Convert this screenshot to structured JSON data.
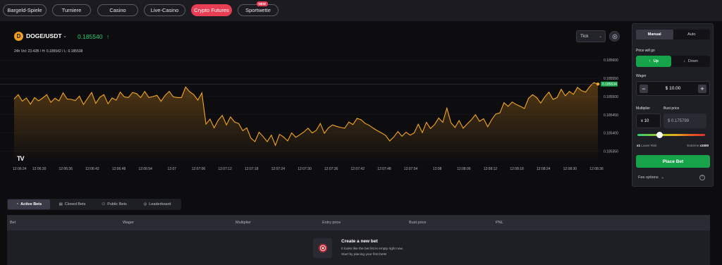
{
  "nav": {
    "items": [
      {
        "label": "Bargeld-Spiele"
      },
      {
        "label": "Turniere"
      },
      {
        "label": "Casino"
      },
      {
        "label": "Live-Casino"
      },
      {
        "label": "Crypto Futures"
      },
      {
        "label": "Sportwette"
      }
    ],
    "new_badge": "NEW"
  },
  "chart_header": {
    "coin_symbol": "D",
    "pair": "DOGE/USDT",
    "price": "0.185540",
    "price_arrow": "↑",
    "stats": "24h Vol: 23.42B / H: 0.185542 / L: 0.185538",
    "interval": "Tick"
  },
  "chart_data": {
    "type": "area",
    "series_color": "#f5a623",
    "current_price_label": "0.185534",
    "y_ticks": [
      "0.185600",
      "0.185550",
      "0.185500",
      "0.185450",
      "0.185400",
      "0.185350"
    ],
    "x_ticks": [
      "12:06:24",
      "12:06:30",
      "12:06:36",
      "12:06:42",
      "12:06:48",
      "12:06:54",
      "12:07",
      "12:07:06",
      "12:07:12",
      "12:07:18",
      "12:07:24",
      "12:07:30",
      "12:07:36",
      "12:07:42",
      "12:07:48",
      "12:07:54",
      "12:08",
      "12:08:06",
      "12:08:12",
      "12:08:18",
      "12:08:24",
      "12:08:30",
      "12:08:36"
    ],
    "ylim": [
      0.18532,
      0.18561
    ],
    "values": [
      0.185493,
      0.185505,
      0.185487,
      0.185496,
      0.185479,
      0.185497,
      0.185488,
      0.185496,
      0.185505,
      0.185484,
      0.185495,
      0.185488,
      0.18551,
      0.185493,
      0.185492,
      0.185489,
      0.185501,
      0.185478,
      0.185495,
      0.185511,
      0.185481,
      0.185498,
      0.185505,
      0.18548,
      0.185496,
      0.18549,
      0.185512,
      0.185499,
      0.185497,
      0.185511,
      0.185508,
      0.185497,
      0.185514,
      0.185497,
      0.1855,
      0.185503,
      0.185487,
      0.185503,
      0.185514,
      0.185499,
      0.185497,
      0.185497,
      0.185526,
      0.185513,
      0.185505,
      0.18549,
      0.18551,
      0.185424,
      0.185438,
      0.185414,
      0.185435,
      0.185448,
      0.185422,
      0.185444,
      0.18543,
      0.185426,
      0.185406,
      0.185414,
      0.185386,
      0.185376,
      0.185402,
      0.18539,
      0.185376,
      0.185394,
      0.185366,
      0.185396,
      0.185389,
      0.185378,
      0.1854,
      0.185388,
      0.185395,
      0.185403,
      0.185413,
      0.1854,
      0.185407,
      0.185426,
      0.185399,
      0.185414,
      0.185422,
      0.185418,
      0.185415,
      0.185413,
      0.18543,
      0.185423,
      0.18544,
      0.185436,
      0.185426,
      0.185421,
      0.185413,
      0.185406,
      0.1854,
      0.185393,
      0.185378,
      0.185389,
      0.185404,
      0.185391,
      0.185402,
      0.185394,
      0.1854,
      0.185424,
      0.185401,
      0.185429,
      0.185412,
      0.185423,
      0.185441,
      0.185429,
      0.185468,
      0.185428,
      0.185415,
      0.185434,
      0.185413,
      0.185425,
      0.185436,
      0.18545,
      0.185432,
      0.185439,
      0.185417,
      0.185437,
      0.185452,
      0.185455,
      0.185483,
      0.185473,
      0.185485,
      0.185478,
      0.185473,
      0.185467,
      0.185495,
      0.185505,
      0.185497,
      0.185482,
      0.185499,
      0.185512,
      0.185492,
      0.185497,
      0.18552,
      0.185502,
      0.185514,
      0.185506,
      0.185525,
      0.185516,
      0.185512,
      0.185527,
      0.185538,
      0.185534
    ]
  },
  "panel": {
    "tabs": [
      "Manual",
      "Auto"
    ],
    "direction_label": "Price will go",
    "up_label": "Up",
    "down_label": "Down",
    "wager_label": "Wager",
    "wager_value": "$ 10.00",
    "minus": "−",
    "plus": "+",
    "multiplier_label": "Multiplier",
    "multiplier_value": "x 10",
    "bust_label": "Bust price",
    "bust_value": "$ 0.175799",
    "slider_level": 0.35,
    "risk_min": "x1",
    "risk_low": "Lower Risk",
    "risk_high": "Extreme",
    "risk_max": "x1000",
    "place_bet": "Place Bet",
    "fee_options": "Fee options",
    "help": "?"
  },
  "bets": {
    "tabs": [
      "Active Bets",
      "Closed Bets",
      "Public Bets",
      "Leaderboard"
    ],
    "columns": [
      "Bet",
      "Wager",
      "Multiplier",
      "Entry price",
      "Bust price",
      "PNL"
    ],
    "empty_title": "Create a new bet",
    "empty_line1": "It looks like the bet list is empty right now.",
    "empty_line2": "Start by placing your first bets!"
  }
}
